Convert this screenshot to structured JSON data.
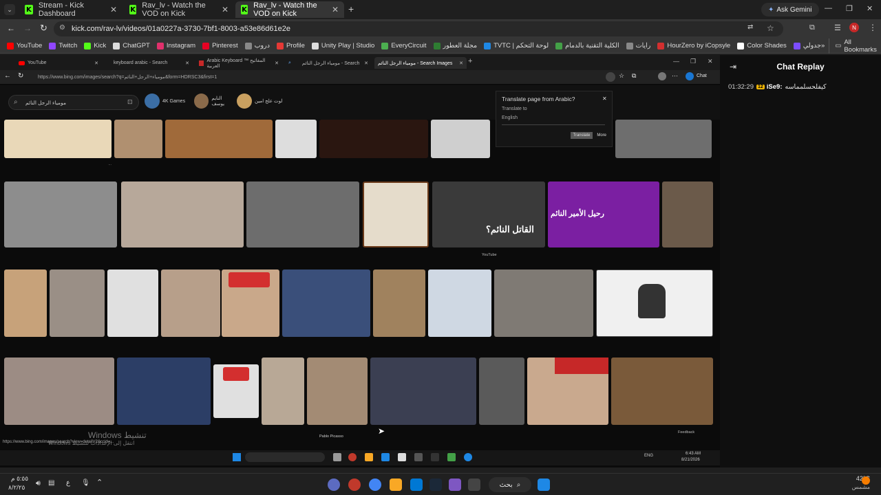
{
  "browser": {
    "tabs": [
      {
        "label": "Stream - Kick Dashboard",
        "active": false
      },
      {
        "label": "Rav_lv - Watch the VOD on Kick",
        "active": false
      },
      {
        "label": "Rav_lv - Watch the VOD on Kick",
        "active": true
      }
    ],
    "ask_gemini": "Ask Gemini",
    "url": "kick.com/rav-lv/videos/01a0227a-3730-7bf1-8003-a53e86d61e2e",
    "bookmarks": [
      {
        "label": "YouTube",
        "color": "#ff0000"
      },
      {
        "label": "Twitch",
        "color": "#9146ff"
      },
      {
        "label": "Kick",
        "color": "#53fc18"
      },
      {
        "label": "ChatGPT",
        "color": "#dddddd"
      },
      {
        "label": "Instagram",
        "color": "#e1306c"
      },
      {
        "label": "Pinterest",
        "color": "#e60023"
      },
      {
        "label": "دروب",
        "color": "#888888"
      },
      {
        "label": "Profile",
        "color": "#e53935"
      },
      {
        "label": "Unity Play | Studio",
        "color": "#dddddd"
      },
      {
        "label": "EveryCircuit",
        "color": "#4caf50"
      },
      {
        "label": "مجلة العطور",
        "color": "#2e7d32"
      },
      {
        "label": "TVTC | لوحة التحكم",
        "color": "#1e88e5"
      },
      {
        "label": "الكلية التقنية بالدمام",
        "color": "#43a047"
      },
      {
        "label": "رايات",
        "color": "#888888"
      },
      {
        "label": "HourZero by iCopsyle",
        "color": "#d32f2f"
      },
      {
        "label": "Color Shades",
        "color": "#ffffff"
      },
      {
        "label": "جدولي",
        "color": "#7c4dff"
      }
    ],
    "all_bookmarks": "All Bookmarks"
  },
  "vod": {
    "inner_tabs": [
      {
        "label": "YouTube",
        "active": false
      },
      {
        "label": "keyboard arabic - Search",
        "active": false
      },
      {
        "label": "Arabic Keyboard ™ المفاتيح العربية",
        "active": false
      },
      {
        "label": "مومياء الرجل النائم - Search",
        "active": false
      },
      {
        "label": "مومياء الرجل النائم - Search Images",
        "active": true
      }
    ],
    "inner_url": "https://www.bing.com/images/search?q=مومياء+الرجل+النائم&form=HDRSC3&first=1",
    "search_query": "مومياء الرجل النائم",
    "chips": [
      {
        "label": "4K Games",
        "color": "#3b6ea5"
      },
      {
        "label": "النايم يوسف",
        "color": "#8a6a4a"
      },
      {
        "label": "لوت علج امين",
        "color": "#c9a060"
      }
    ],
    "translate": {
      "title": "Translate page from Arabic?",
      "to_label": "Translate to",
      "language": "English",
      "translate_button": "Translate",
      "more_button": "More"
    },
    "captions": {
      "youtube": "YouTube",
      "feedback": "Feedback",
      "picasso": "Pablo Picasso",
      "status_url": "https://www.bing.com/images/search?view=detailV2&ccid=...",
      "watermark_1": "Windows تنشيط",
      "watermark_2": "Windows انتقل إلى الإعدادات لتنشيط"
    },
    "inner_clock": "6:43 AM",
    "inner_date": "8/21/2026",
    "inner_lang": "ENG"
  },
  "chat": {
    "title": "Chat Replay",
    "messages": [
      {
        "time": "01:32:29",
        "badge": "12",
        "user": "iSe9:",
        "text": "كيفلحسلمماسه"
      }
    ]
  },
  "os": {
    "search_placeholder": "بحث",
    "clock": "٥:٥٥ م",
    "date": "٨/٢/٢٥",
    "lang": "ع",
    "weather_temp": "42°C",
    "weather_desc": "مشمس"
  }
}
